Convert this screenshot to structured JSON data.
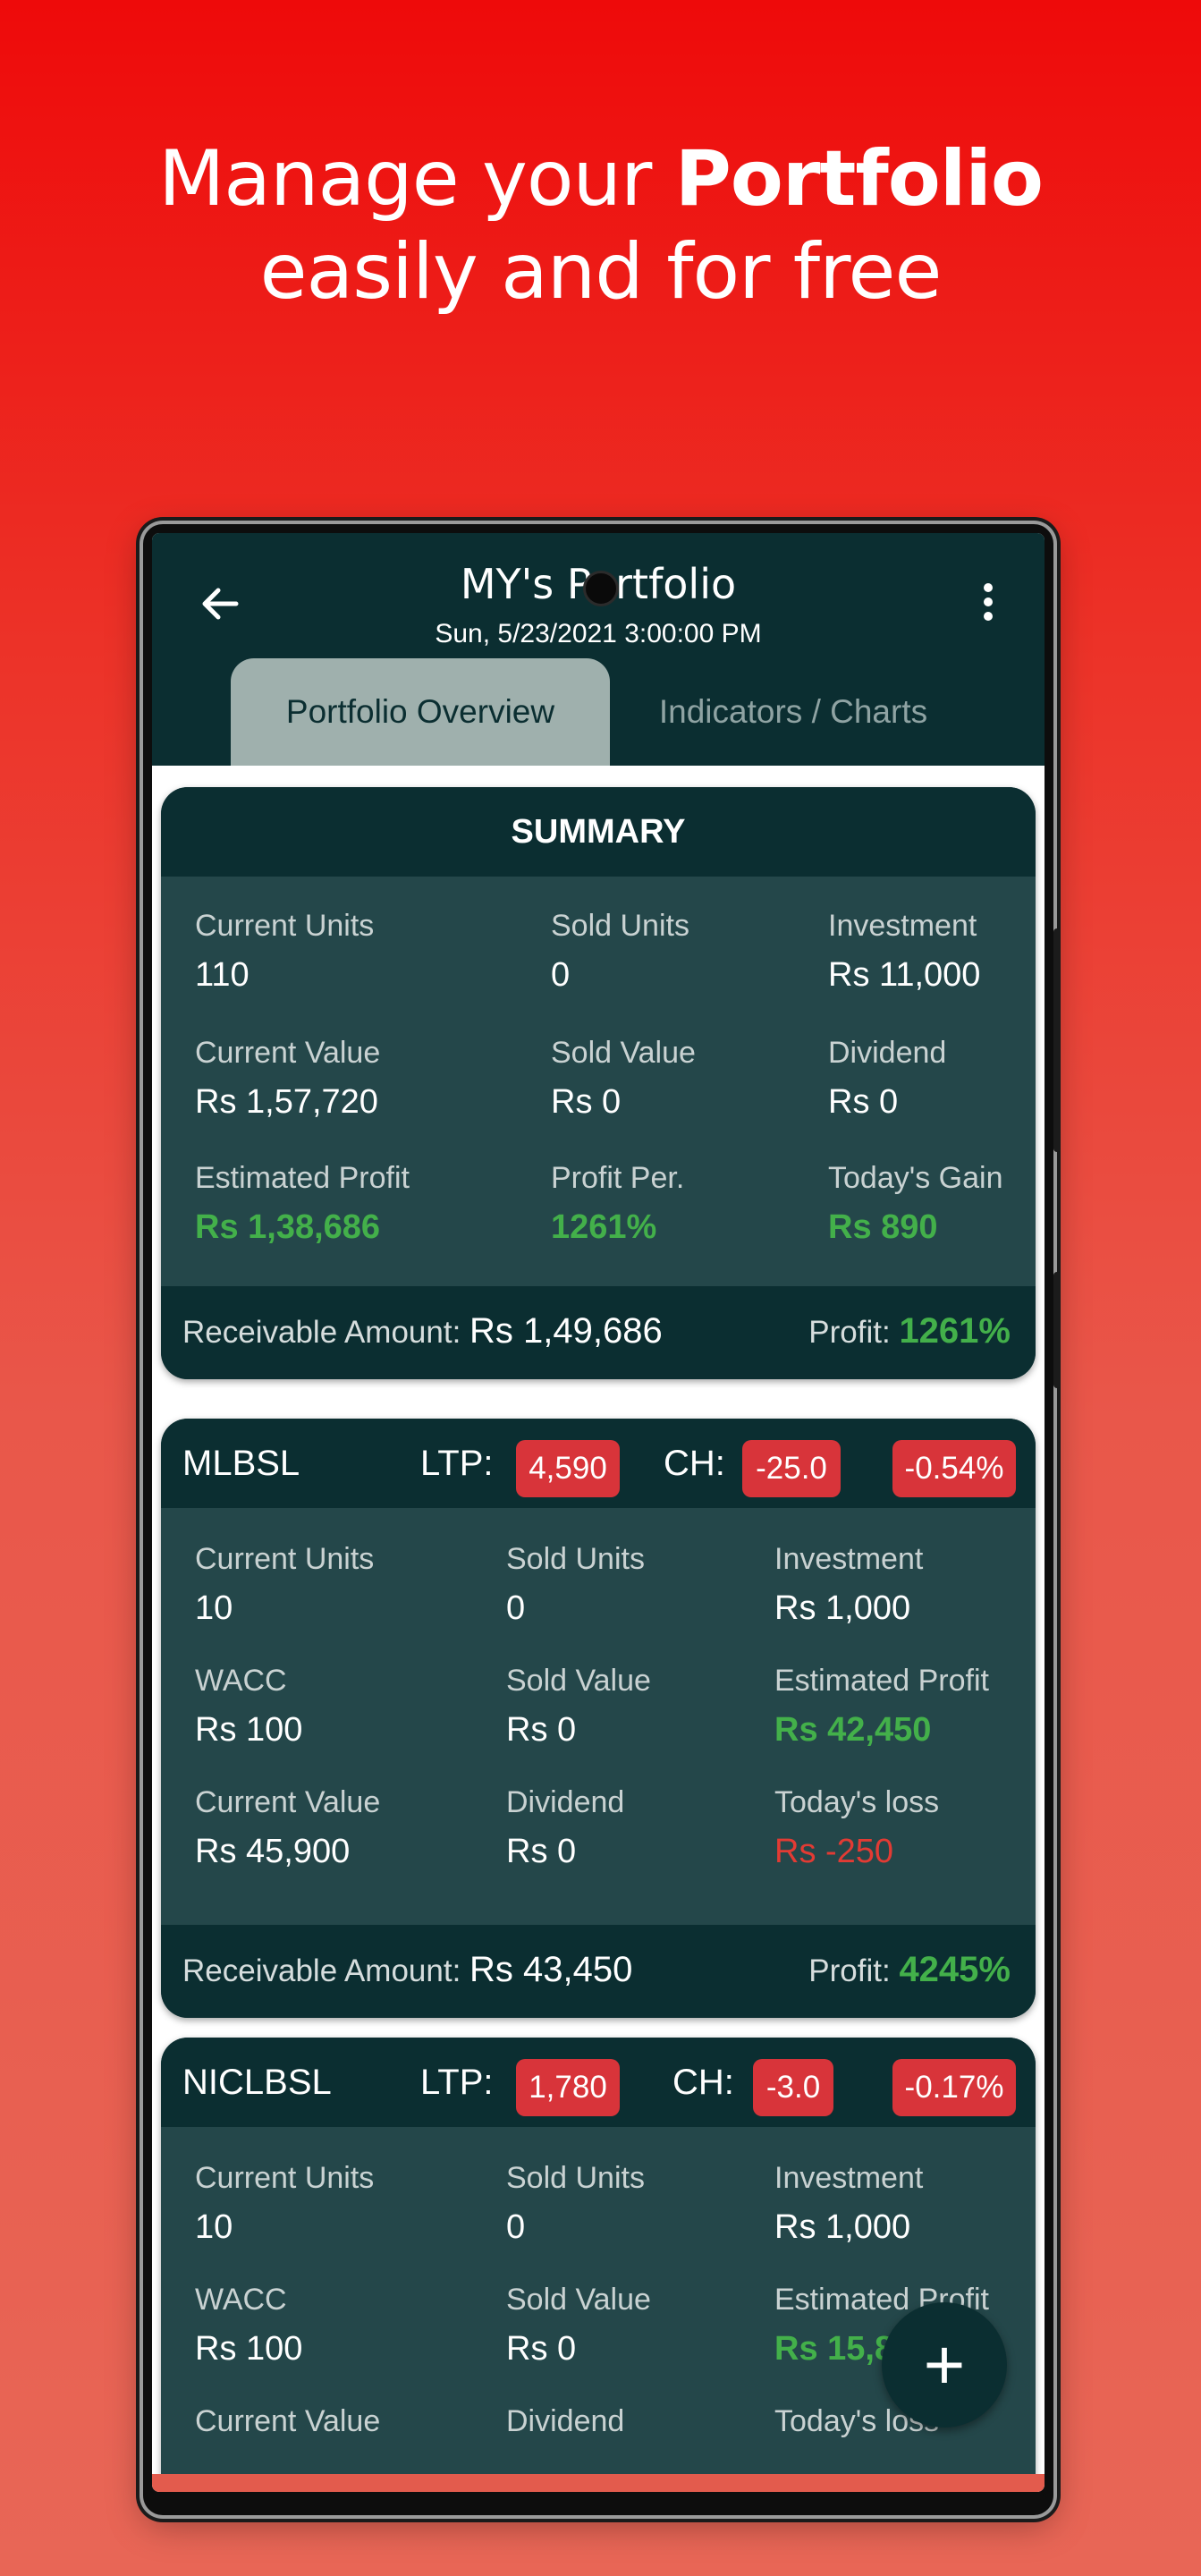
{
  "promo": {
    "line1_pre": "Manage your ",
    "line1_bold": "Portfolio",
    "line2": "easily and for free"
  },
  "appbar": {
    "title": "MY's Portfolio",
    "subtitle": "Sun, 5/23/2021 3:00:00 PM",
    "back_icon": "arrow-left-icon",
    "menu_icon": "more-vertical-icon"
  },
  "tabs": [
    {
      "label": "Portfolio Overview",
      "active": true
    },
    {
      "label": "Indicators / Charts",
      "active": false
    }
  ],
  "summary": {
    "title": "SUMMARY",
    "cells": [
      {
        "label": "Current Units",
        "value": "110"
      },
      {
        "label": "Sold Units",
        "value": "0"
      },
      {
        "label": "Investment",
        "value": "Rs 11,000"
      },
      {
        "label": "Current Value",
        "value": "Rs 1,57,720"
      },
      {
        "label": "Sold Value",
        "value": "Rs 0"
      },
      {
        "label": "Dividend",
        "value": "Rs 0"
      },
      {
        "label": "Estimated Profit",
        "value": "Rs 1,38,686"
      },
      {
        "label": "Profit Per.",
        "value": "1261%"
      },
      {
        "label": "Today's Gain",
        "value": "Rs 890"
      }
    ],
    "receivable_label": "Receivable Amount:",
    "receivable_value": "Rs 1,49,686",
    "profit_label": "Profit:",
    "profit_value": "1261%"
  },
  "stocks": [
    {
      "symbol": "MLBSL",
      "ltp_label": "LTP:",
      "ltp": "4,590",
      "ch_label": "CH:",
      "ch": "-25.0",
      "ch_pct": "-0.54%",
      "cells": [
        {
          "label": "Current Units",
          "value": "10"
        },
        {
          "label": "Sold Units",
          "value": "0"
        },
        {
          "label": "Investment",
          "value": "Rs 1,000"
        },
        {
          "label": "WACC",
          "value": "Rs 100"
        },
        {
          "label": "Sold Value",
          "value": "Rs 0"
        },
        {
          "label": "Estimated Profit",
          "value": "Rs 42,450"
        },
        {
          "label": "Current Value",
          "value": "Rs 45,900"
        },
        {
          "label": "Dividend",
          "value": "Rs 0"
        },
        {
          "label": "Today's loss",
          "value": "Rs -250"
        }
      ],
      "receivable_label": "Receivable Amount:",
      "receivable_value": "Rs 43,450",
      "profit_label": "Profit:",
      "profit_value": "4245%"
    },
    {
      "symbol": "NICLBSL",
      "ltp_label": "LTP:",
      "ltp": "1,780",
      "ch_label": "CH:",
      "ch": "-3.0",
      "ch_pct": "-0.17%",
      "cells": [
        {
          "label": "Current Units",
          "value": "10"
        },
        {
          "label": "Sold Units",
          "value": "0"
        },
        {
          "label": "Investment",
          "value": "Rs 1,000"
        },
        {
          "label": "WACC",
          "value": "Rs 100"
        },
        {
          "label": "Sold Value",
          "value": "Rs 0"
        },
        {
          "label": "Estimated Profit",
          "value": "Rs 15,8"
        },
        {
          "label": "Current Value",
          "value": ""
        },
        {
          "label": "Dividend",
          "value": ""
        },
        {
          "label": "Today's loss",
          "value": ""
        }
      ]
    }
  ],
  "fab": {
    "label": "+",
    "icon": "plus-icon"
  },
  "colors": {
    "header": "#0b2e31",
    "card": "#24474a",
    "profit": "#43b04a",
    "loss": "#e23b34",
    "chip": "#d8343a"
  }
}
